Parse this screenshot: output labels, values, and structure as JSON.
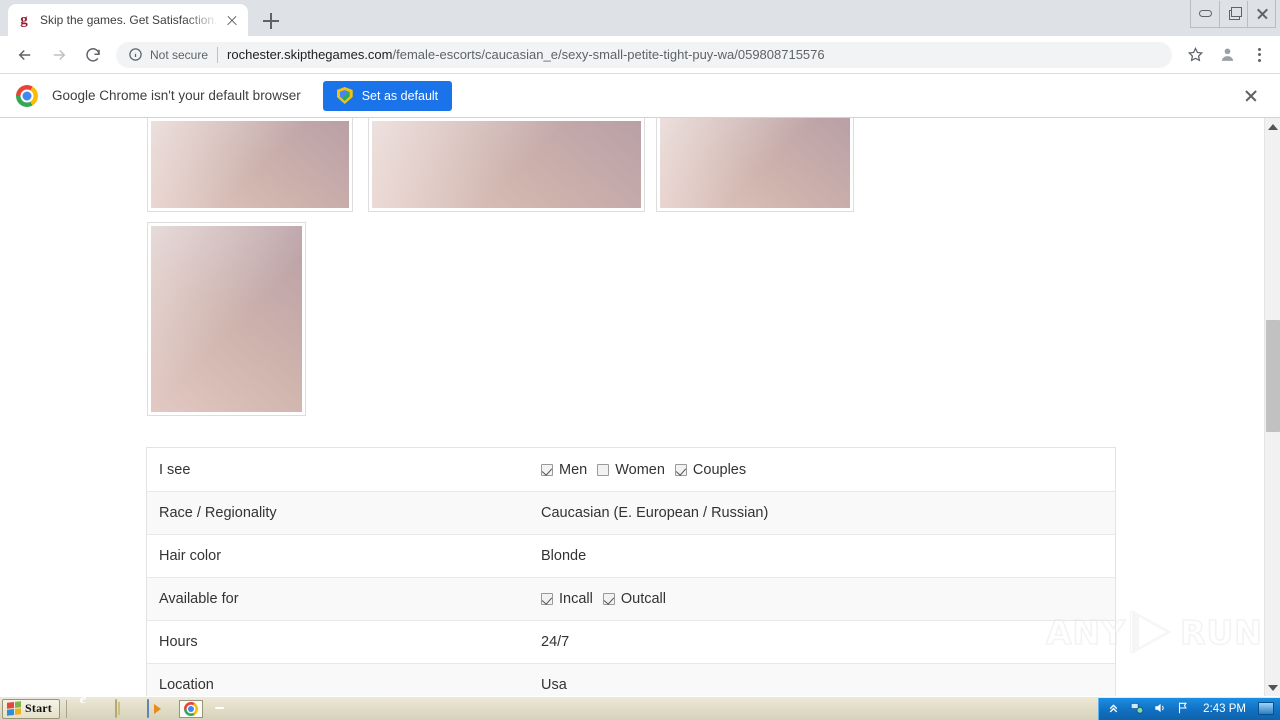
{
  "browser": {
    "tab": {
      "title": "Skip the games. Get Satisfaction. Me",
      "favicon_letter": "g"
    },
    "omnibox": {
      "security_label": "Not secure",
      "url_domain": "rochester.skipthegames.com",
      "url_path": "/female-escorts/caucasian_e/sexy-small-petite-tight-puy-wa/059808715576"
    },
    "infobar": {
      "message": "Google Chrome isn't your default browser",
      "button_label": "Set as default"
    }
  },
  "page": {
    "thumbnails": [
      {
        "alt": "gallery-thumbnail-1"
      },
      {
        "alt": "gallery-thumbnail-2"
      },
      {
        "alt": "gallery-thumbnail-3"
      },
      {
        "alt": "gallery-thumbnail-4"
      }
    ],
    "info_table": {
      "rows": [
        {
          "label": "I see",
          "type": "checkboxes",
          "options": [
            {
              "label": "Men",
              "checked": true
            },
            {
              "label": "Women",
              "checked": false
            },
            {
              "label": "Couples",
              "checked": true
            }
          ]
        },
        {
          "label": "Race / Regionality",
          "type": "text",
          "value": "Caucasian (E. European / Russian)"
        },
        {
          "label": "Hair color",
          "type": "text",
          "value": "Blonde"
        },
        {
          "label": "Available for",
          "type": "checkboxes",
          "options": [
            {
              "label": "Incall",
              "checked": true
            },
            {
              "label": "Outcall",
              "checked": true
            }
          ]
        },
        {
          "label": "Hours",
          "type": "text",
          "value": "24/7"
        },
        {
          "label": "Location",
          "type": "text",
          "value": "Usa"
        }
      ]
    },
    "watermark": {
      "text_left": "ANY",
      "text_right": "RUN"
    }
  },
  "taskbar": {
    "start_label": "Start",
    "quick_launch": [
      "internet-explorer-icon",
      "folder-icon",
      "media-player-icon",
      "chrome-icon",
      "stop-icon"
    ],
    "tray": {
      "time": "2:43 PM"
    }
  },
  "colors": {
    "chrome_tabstrip": "#dee1e6",
    "accent_blue": "#1a73e8",
    "omnibox_bg": "#f1f3f4",
    "table_alt_row": "#f9f9f9",
    "taskbar_bg": "#ece9d8",
    "tray_blue": "#1272c4"
  }
}
